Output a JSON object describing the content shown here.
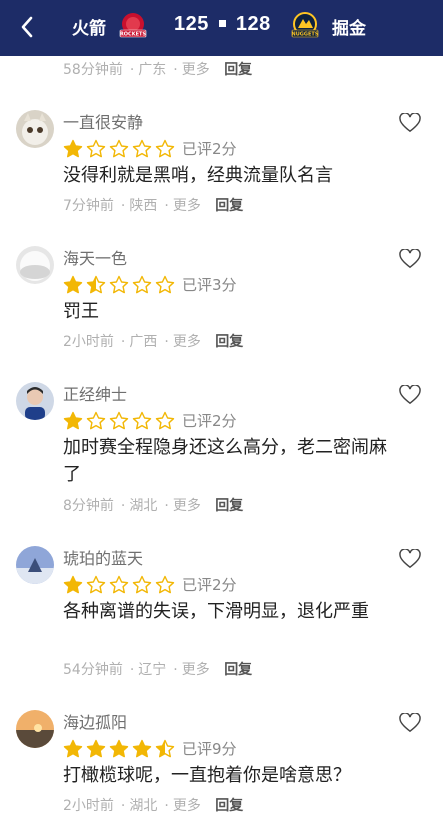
{
  "header": {
    "home_team": "火箭",
    "away_team": "掘金",
    "home_score": "125",
    "away_score": "128",
    "home_logo_text": "ROCKETS",
    "away_logo_text": "NUGGETS",
    "bg_color": "#1d2c67"
  },
  "top_meta": {
    "time": "58分钟前",
    "region": "广东",
    "more": "更多",
    "reply": "回复"
  },
  "comments": [
    {
      "user": "一直很安静",
      "stars": 1,
      "rated": "已评2分",
      "text": "没得利就是黑哨，经典流量队名言",
      "time": "7分钟前",
      "region": "陕西",
      "more": "更多",
      "reply": "回复"
    },
    {
      "user": "海天一色",
      "stars": 1.5,
      "rated": "已评3分",
      "text": "罚王",
      "time": "2小时前",
      "region": "广西",
      "more": "更多",
      "reply": "回复"
    },
    {
      "user": "正经绅士",
      "stars": 1,
      "rated": "已评2分",
      "text": "加时赛全程隐身还这么高分，老二密闹麻了",
      "time": "8分钟前",
      "region": "湖北",
      "more": "更多",
      "reply": "回复"
    },
    {
      "user": "琥珀的蓝天",
      "stars": 1,
      "rated": "已评2分",
      "text": "各种离谱的失误，下滑明显，退化严重",
      "time": "54分钟前",
      "region": "辽宁",
      "more": "更多",
      "reply": "回复"
    },
    {
      "user": "海边孤阳",
      "stars": 4.5,
      "rated": "已评9分",
      "text": "打橄榄球呢，一直抱着你是啥意思？",
      "time": "2小时前",
      "region": "湖北",
      "more": "更多",
      "reply": "回复"
    }
  ],
  "star_color": "#f2b705"
}
